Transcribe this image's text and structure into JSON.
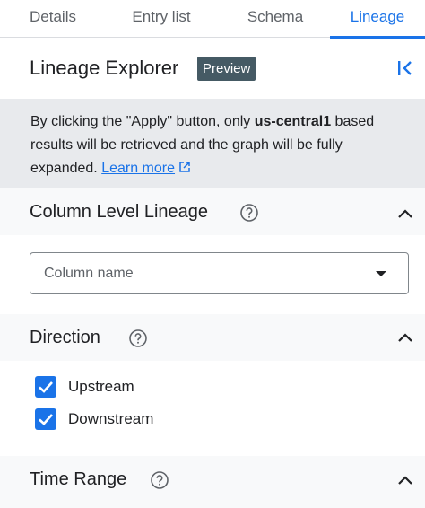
{
  "tabs": [
    {
      "label": "Details"
    },
    {
      "label": "Entry list"
    },
    {
      "label": "Schema"
    },
    {
      "label": "Lineage"
    }
  ],
  "active_tab": "Lineage",
  "header": {
    "title": "Lineage Explorer",
    "badge": "Preview",
    "collapse_icon": "collapse-left-icon"
  },
  "info": {
    "text_before": "By clicking the \"Apply\" button, only ",
    "region": "us-central1",
    "text_after": " based results will be retrieved and the graph will be fully expanded. ",
    "link": "Learn more",
    "link_icon": "open-in-new-icon"
  },
  "column_lineage": {
    "title": "Column Level Lineage",
    "select_placeholder": "Column name"
  },
  "direction": {
    "title": "Direction",
    "options": [
      {
        "label": "Upstream",
        "checked": true
      },
      {
        "label": "Downstream",
        "checked": true
      }
    ]
  },
  "time_range": {
    "title": "Time Range"
  },
  "colors": {
    "accent": "#1a73e8",
    "badge_bg": "#455a64",
    "info_bg": "#e8eaed"
  }
}
